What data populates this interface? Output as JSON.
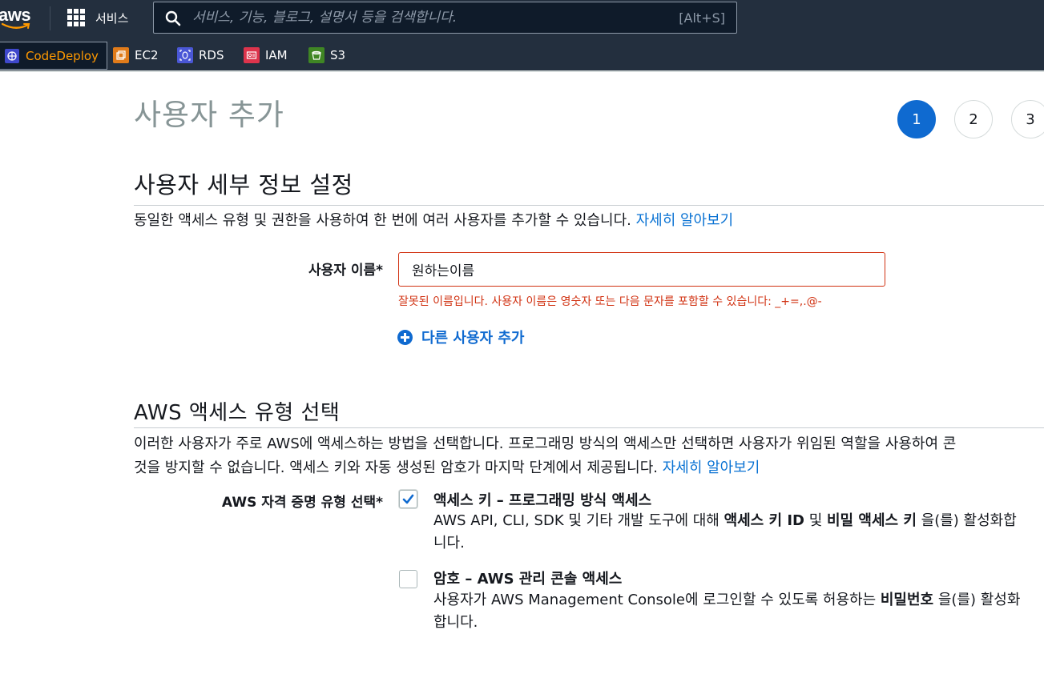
{
  "header": {
    "logo_text": "aws",
    "services_label": "서비스",
    "search_placeholder": "서비스, 기능, 블로그, 설명서 등을 검색합니다.",
    "search_shortcut": "[Alt+S]"
  },
  "favorites": [
    {
      "label": "CodeDeploy",
      "color": "#3f48cc",
      "active": true
    },
    {
      "label": "EC2",
      "color": "#e07b1a"
    },
    {
      "label": "RDS",
      "color": "#4a57d6"
    },
    {
      "label": "IAM",
      "color": "#dd344c"
    },
    {
      "label": "S3",
      "color": "#3f8624"
    }
  ],
  "page": {
    "title": "사용자 추가",
    "steps": [
      "1",
      "2",
      "3"
    ],
    "current_step": 1
  },
  "details": {
    "title": "사용자 세부 정보 설정",
    "description": "동일한 액세스 유형 및 권한을 사용하여 한 번에 여러 사용자를 추가할 수 있습니다.",
    "learn_more": "자세히 알아보기",
    "username_label": "사용자 이름*",
    "username_value": "원하는이름",
    "error": "잘못된 이름입니다. 사용자 이름은 영숫자 또는 다음 문자를 포함할 수 있습니다: _+=,.@-",
    "add_user": "다른 사용자 추가"
  },
  "access": {
    "title": "AWS 액세스 유형 선택",
    "description_line1": "이러한 사용자가 주로 AWS에 액세스하는 방법을 선택합니다. 프로그래밍 방식의 액세스만 선택하면 사용자가 위임된 역할을 사용하여 콘",
    "description_line2": "것을 방지할 수 없습니다. 액세스 키와 자동 생성된 암호가 마지막 단계에서 제공됩니다.",
    "learn_more": "자세히 알아보기",
    "credential_label": "AWS 자격 증명 유형 선택*",
    "options": [
      {
        "title": "액세스 키 – 프로그래밍 방식 액세스",
        "checked": true,
        "desc_a": "AWS API, CLI, SDK 및 기타 개발 도구에 대해 ",
        "desc_b": "액세스 키 ID",
        "desc_c": " 및 ",
        "desc_d": "비밀 액세스 키",
        "desc_e": " 을(를) 활성화합니다."
      },
      {
        "title": "암호 – AWS 관리 콘솔 액세스",
        "checked": false,
        "desc_a": "사용자가 AWS Management Console에 로그인할 수 있도록 허용하는 ",
        "desc_b": "비밀번호",
        "desc_c": " 을(를) 활성화합니다."
      }
    ]
  }
}
